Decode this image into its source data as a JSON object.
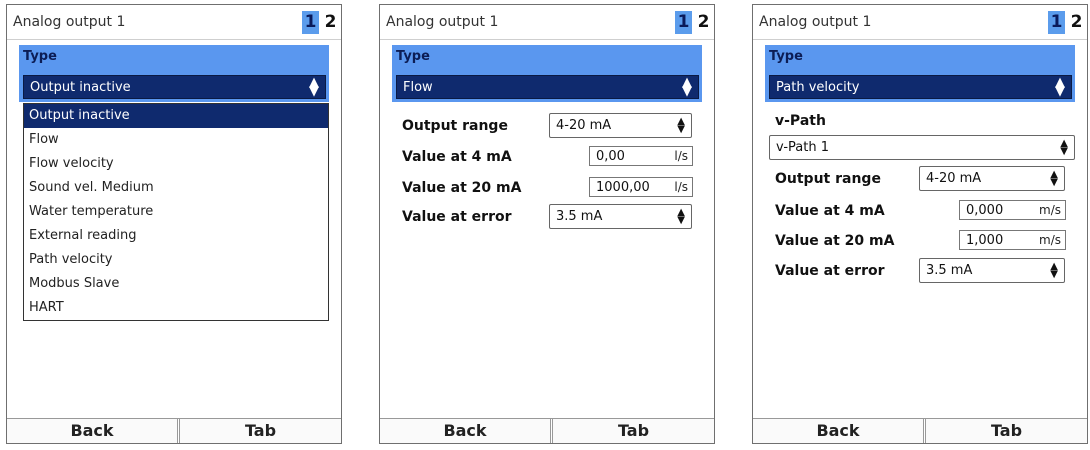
{
  "screens": [
    {
      "title": "Analog output 1",
      "pages": [
        "1",
        "2"
      ],
      "type_label": "Type",
      "type_value": "Output inactive",
      "dropdown_options": [
        "Output inactive",
        "Flow",
        "Flow velocity",
        "Sound vel. Medium",
        "Water temperature",
        "External reading",
        "Path velocity",
        "Modbus Slave",
        "HART"
      ],
      "softkeys": {
        "back": "Back",
        "tab": "Tab"
      }
    },
    {
      "title": "Analog output 1",
      "pages": [
        "1",
        "2"
      ],
      "type_label": "Type",
      "type_value": "Flow",
      "output_range": {
        "label": "Output range",
        "value": "4-20 mA"
      },
      "value_at_4": {
        "label": "Value at 4 mA",
        "value": "0,00",
        "unit": "l/s"
      },
      "value_at_20": {
        "label": "Value at 20 mA",
        "value": "1000,00",
        "unit": "l/s"
      },
      "value_at_error": {
        "label": "Value at error",
        "value": "3.5 mA"
      },
      "softkeys": {
        "back": "Back",
        "tab": "Tab"
      }
    },
    {
      "title": "Analog output 1",
      "pages": [
        "1",
        "2"
      ],
      "type_label": "Type",
      "type_value": "Path velocity",
      "v_path": {
        "label": "v-Path",
        "value": "v-Path 1"
      },
      "output_range": {
        "label": "Output range",
        "value": "4-20 mA"
      },
      "value_at_4": {
        "label": "Value at 4 mA",
        "value": "0,000",
        "unit": "m/s"
      },
      "value_at_20": {
        "label": "Value at 20 mA",
        "value": "1,000",
        "unit": "m/s"
      },
      "value_at_error": {
        "label": "Value at error",
        "value": "3.5 mA"
      },
      "softkeys": {
        "back": "Back",
        "tab": "Tab"
      }
    }
  ],
  "colors": {
    "accent_band": "#5a97ef",
    "selected_dark": "#0f2a6e",
    "page_active": "#5b9cec"
  },
  "icons": {
    "stepper": "up-down-arrows-icon"
  }
}
